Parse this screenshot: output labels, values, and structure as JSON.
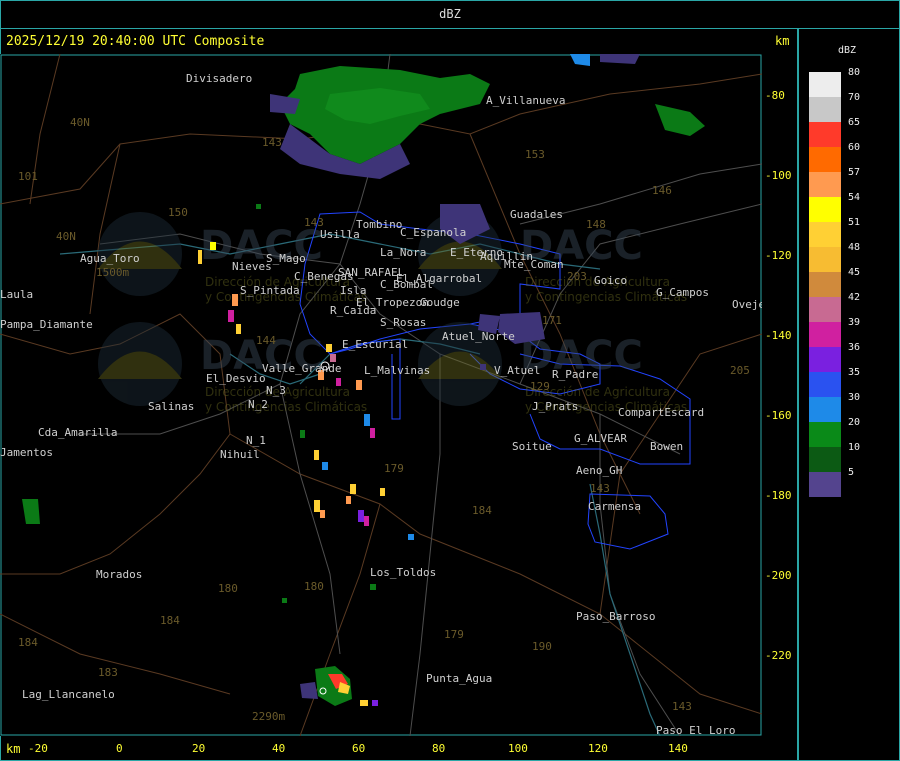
{
  "header": {
    "title": "dBZ"
  },
  "map": {
    "timestamp": "2025/12/19 20:40:00 UTC Composite",
    "axis_unit_top": "km",
    "axis_unit_bottom": "km",
    "y_ticks": [
      "-80",
      "-100",
      "-120",
      "-140",
      "-160",
      "-180",
      "-200",
      "-220"
    ],
    "x_ticks": [
      "-20",
      "0",
      "20",
      "40",
      "60",
      "80",
      "100",
      "120",
      "140"
    ],
    "places": [
      "Divisadero",
      "A_Villanueva",
      "Guadales",
      "Usilla",
      "Tombino",
      "C_Espanola",
      "E_Eterno",
      "Aquillin",
      "Mte_Coman",
      "Goico",
      "G_Campos",
      "Oveje",
      "Agua_Toro",
      "Nieves",
      "S_Mago",
      "S_Pintada",
      "C_Benegas",
      "SAN_RAFAEL",
      "El_Algarrobal",
      "C_Bombal",
      "La_Nora",
      "Isla",
      "El_Tropezon",
      "Goudge",
      "R_Caida",
      "S_Rosas",
      "Atuel_Norte",
      "E_Escurial",
      "El_Desvio",
      "Valle_Grande",
      "L_Malvinas",
      "V_Atuel",
      "R_Padre",
      "Salinas",
      "N_2",
      "N_3",
      "J_Prats",
      "CompartEscard",
      "G_ALVEAR",
      "Bowen",
      "Soitue",
      "N_1",
      "Nihuil",
      "Cda_Amarilla",
      "Aeno_GH",
      "Carmensa",
      "Los_Toldos",
      "Morados",
      "Paso_Barroso",
      "Punta_Agua",
      "Lag_Llancanelo",
      "Paso_El_Loro",
      "Pampa_Diamante",
      "Laula",
      "Jamentos",
      "40N",
      "40N",
      "2290m",
      "1500m"
    ],
    "road_numbers": [
      "101",
      "143",
      "153",
      "146",
      "150",
      "143",
      "148",
      "203",
      "144",
      "171",
      "180",
      "184",
      "179",
      "190",
      "184",
      "180",
      "183",
      "184",
      "143",
      "143",
      "205",
      "129",
      "179"
    ],
    "watermark": {
      "brand": "DACC",
      "line1": "Dirección de Agricultura",
      "line2": "y Contingencias Climáticas"
    }
  },
  "legend": {
    "title": "dBZ",
    "items": [
      {
        "label": "80",
        "color": "#ededed"
      },
      {
        "label": "70",
        "color": "#c8c8c8"
      },
      {
        "label": "65",
        "color": "#ff3a2a"
      },
      {
        "label": "60",
        "color": "#ff6a00"
      },
      {
        "label": "57",
        "color": "#ff9a50"
      },
      {
        "label": "54",
        "color": "#ffff00"
      },
      {
        "label": "51",
        "color": "#ffd034"
      },
      {
        "label": "48",
        "color": "#f7bc32"
      },
      {
        "label": "45",
        "color": "#d08a3c"
      },
      {
        "label": "42",
        "color": "#c86a92"
      },
      {
        "label": "39",
        "color": "#d020a0"
      },
      {
        "label": "36",
        "color": "#7a20e0"
      },
      {
        "label": "35",
        "color": "#2a52f0"
      },
      {
        "label": "30",
        "color": "#1e8ae8"
      },
      {
        "label": "20",
        "color": "#0a8a18"
      },
      {
        "label": "10",
        "color": "#0c5a14"
      },
      {
        "label": "5",
        "color": "#54448e"
      }
    ]
  }
}
